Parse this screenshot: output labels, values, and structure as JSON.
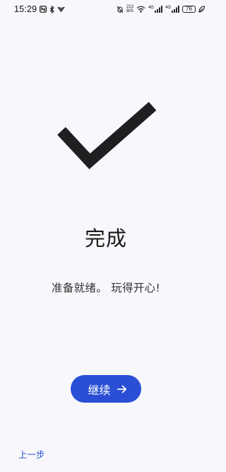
{
  "status_bar": {
    "time": "15:29",
    "net_speed_value": "213",
    "net_speed_unit": "B/S",
    "network_label_1": "4G",
    "network_label_2": "4G",
    "battery_level": "76"
  },
  "main": {
    "title": "完成",
    "subtitle": "准备就绪。 玩得开心!"
  },
  "actions": {
    "continue_label": "继续",
    "back_label": "上一步"
  },
  "colors": {
    "accent": "#2a4fd6",
    "background": "#f8f7fb",
    "check": "#1f1f22"
  },
  "icons": {
    "check": "checkmark-icon",
    "continue": "arrow-right-icon"
  }
}
